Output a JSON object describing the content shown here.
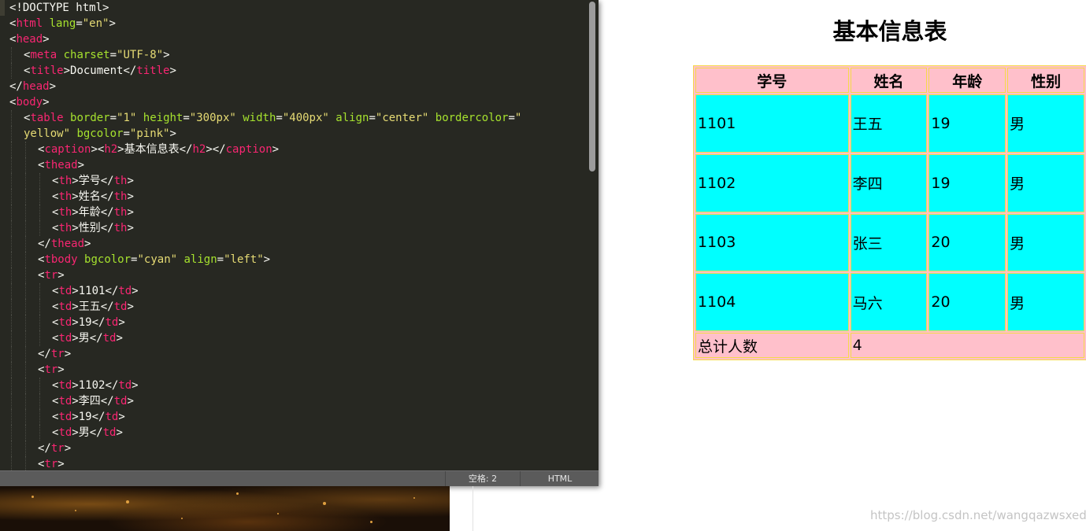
{
  "editor": {
    "lines": [
      [
        {
          "c": "p",
          "v": "<!DOCTYPE html>"
        }
      ],
      [
        {
          "c": "p",
          "v": "<"
        },
        {
          "c": "t",
          "v": "html"
        },
        {
          "c": "p",
          "v": " "
        },
        {
          "c": "a",
          "v": "lang"
        },
        {
          "c": "p",
          "v": "="
        },
        {
          "c": "s",
          "v": "\"en\""
        },
        {
          "c": "p",
          "v": ">"
        }
      ],
      [
        {
          "c": "p",
          "v": "<"
        },
        {
          "c": "t",
          "v": "head"
        },
        {
          "c": "p",
          "v": ">"
        }
      ],
      [
        {
          "c": "p",
          "v": "<"
        },
        {
          "c": "t",
          "v": "meta"
        },
        {
          "c": "p",
          "v": " "
        },
        {
          "c": "a",
          "v": "charset"
        },
        {
          "c": "p",
          "v": "="
        },
        {
          "c": "s",
          "v": "\"UTF-8\""
        },
        {
          "c": "p",
          "v": ">"
        }
      ],
      [
        {
          "c": "p",
          "v": "<"
        },
        {
          "c": "t",
          "v": "title"
        },
        {
          "c": "p",
          "v": ">Document</"
        },
        {
          "c": "t",
          "v": "title"
        },
        {
          "c": "p",
          "v": ">"
        }
      ],
      [
        {
          "c": "p",
          "v": "</"
        },
        {
          "c": "t",
          "v": "head"
        },
        {
          "c": "p",
          "v": ">"
        }
      ],
      [
        {
          "c": "p",
          "v": "<"
        },
        {
          "c": "t",
          "v": "body"
        },
        {
          "c": "p",
          "v": ">"
        }
      ],
      [
        {
          "c": "p",
          "v": "<"
        },
        {
          "c": "t",
          "v": "table"
        },
        {
          "c": "p",
          "v": " "
        },
        {
          "c": "a",
          "v": "border"
        },
        {
          "c": "p",
          "v": "="
        },
        {
          "c": "s",
          "v": "\"1\""
        },
        {
          "c": "p",
          "v": " "
        },
        {
          "c": "a",
          "v": "height"
        },
        {
          "c": "p",
          "v": "="
        },
        {
          "c": "s",
          "v": "\"300px\""
        },
        {
          "c": "p",
          "v": " "
        },
        {
          "c": "a",
          "v": "width"
        },
        {
          "c": "p",
          "v": "="
        },
        {
          "c": "s",
          "v": "\"400px\""
        },
        {
          "c": "p",
          "v": " "
        },
        {
          "c": "a",
          "v": "align"
        },
        {
          "c": "p",
          "v": "="
        },
        {
          "c": "s",
          "v": "\"center\""
        },
        {
          "c": "p",
          "v": " "
        },
        {
          "c": "a",
          "v": "bordercolor"
        },
        {
          "c": "p",
          "v": "="
        },
        {
          "c": "s",
          "v": "\""
        }
      ],
      [
        {
          "c": "s",
          "v": "yellow\""
        },
        {
          "c": "p",
          "v": " "
        },
        {
          "c": "a",
          "v": "bgcolor"
        },
        {
          "c": "p",
          "v": "="
        },
        {
          "c": "s",
          "v": "\"pink\""
        },
        {
          "c": "p",
          "v": ">"
        }
      ],
      [
        {
          "c": "p",
          "v": "<"
        },
        {
          "c": "t",
          "v": "caption"
        },
        {
          "c": "p",
          "v": "><"
        },
        {
          "c": "t",
          "v": "h2"
        },
        {
          "c": "p",
          "v": ">基本信息表</"
        },
        {
          "c": "t",
          "v": "h2"
        },
        {
          "c": "p",
          "v": "></"
        },
        {
          "c": "t",
          "v": "caption"
        },
        {
          "c": "p",
          "v": ">"
        }
      ],
      [
        {
          "c": "p",
          "v": "<"
        },
        {
          "c": "t",
          "v": "thead"
        },
        {
          "c": "p",
          "v": ">"
        }
      ],
      [
        {
          "c": "p",
          "v": "<"
        },
        {
          "c": "t",
          "v": "th"
        },
        {
          "c": "p",
          "v": ">学号</"
        },
        {
          "c": "t",
          "v": "th"
        },
        {
          "c": "p",
          "v": ">"
        }
      ],
      [
        {
          "c": "p",
          "v": "<"
        },
        {
          "c": "t",
          "v": "th"
        },
        {
          "c": "p",
          "v": ">姓名</"
        },
        {
          "c": "t",
          "v": "th"
        },
        {
          "c": "p",
          "v": ">"
        }
      ],
      [
        {
          "c": "p",
          "v": "<"
        },
        {
          "c": "t",
          "v": "th"
        },
        {
          "c": "p",
          "v": ">年龄</"
        },
        {
          "c": "t",
          "v": "th"
        },
        {
          "c": "p",
          "v": ">"
        }
      ],
      [
        {
          "c": "p",
          "v": "<"
        },
        {
          "c": "t",
          "v": "th"
        },
        {
          "c": "p",
          "v": ">性别</"
        },
        {
          "c": "t",
          "v": "th"
        },
        {
          "c": "p",
          "v": ">"
        }
      ],
      [
        {
          "c": "p",
          "v": "</"
        },
        {
          "c": "t",
          "v": "thead"
        },
        {
          "c": "p",
          "v": ">"
        }
      ],
      [
        {
          "c": "p",
          "v": "<"
        },
        {
          "c": "t",
          "v": "tbody"
        },
        {
          "c": "p",
          "v": " "
        },
        {
          "c": "a",
          "v": "bgcolor"
        },
        {
          "c": "p",
          "v": "="
        },
        {
          "c": "s",
          "v": "\"cyan\""
        },
        {
          "c": "p",
          "v": " "
        },
        {
          "c": "a",
          "v": "align"
        },
        {
          "c": "p",
          "v": "="
        },
        {
          "c": "s",
          "v": "\"left\""
        },
        {
          "c": "p",
          "v": ">"
        }
      ],
      [
        {
          "c": "p",
          "v": "<"
        },
        {
          "c": "t",
          "v": "tr"
        },
        {
          "c": "p",
          "v": ">"
        }
      ],
      [
        {
          "c": "p",
          "v": "<"
        },
        {
          "c": "t",
          "v": "td"
        },
        {
          "c": "p",
          "v": ">1101</"
        },
        {
          "c": "t",
          "v": "td"
        },
        {
          "c": "p",
          "v": ">"
        }
      ],
      [
        {
          "c": "p",
          "v": "<"
        },
        {
          "c": "t",
          "v": "td"
        },
        {
          "c": "p",
          "v": ">王五</"
        },
        {
          "c": "t",
          "v": "td"
        },
        {
          "c": "p",
          "v": ">"
        }
      ],
      [
        {
          "c": "p",
          "v": "<"
        },
        {
          "c": "t",
          "v": "td"
        },
        {
          "c": "p",
          "v": ">19</"
        },
        {
          "c": "t",
          "v": "td"
        },
        {
          "c": "p",
          "v": ">"
        }
      ],
      [
        {
          "c": "p",
          "v": "<"
        },
        {
          "c": "t",
          "v": "td"
        },
        {
          "c": "p",
          "v": ">男</"
        },
        {
          "c": "t",
          "v": "td"
        },
        {
          "c": "p",
          "v": ">"
        }
      ],
      [
        {
          "c": "p",
          "v": "</"
        },
        {
          "c": "t",
          "v": "tr"
        },
        {
          "c": "p",
          "v": ">"
        }
      ],
      [
        {
          "c": "p",
          "v": "<"
        },
        {
          "c": "t",
          "v": "tr"
        },
        {
          "c": "p",
          "v": ">"
        }
      ],
      [
        {
          "c": "p",
          "v": "<"
        },
        {
          "c": "t",
          "v": "td"
        },
        {
          "c": "p",
          "v": ">1102</"
        },
        {
          "c": "t",
          "v": "td"
        },
        {
          "c": "p",
          "v": ">"
        }
      ],
      [
        {
          "c": "p",
          "v": "<"
        },
        {
          "c": "t",
          "v": "td"
        },
        {
          "c": "p",
          "v": ">李四</"
        },
        {
          "c": "t",
          "v": "td"
        },
        {
          "c": "p",
          "v": ">"
        }
      ],
      [
        {
          "c": "p",
          "v": "<"
        },
        {
          "c": "t",
          "v": "td"
        },
        {
          "c": "p",
          "v": ">19</"
        },
        {
          "c": "t",
          "v": "td"
        },
        {
          "c": "p",
          "v": ">"
        }
      ],
      [
        {
          "c": "p",
          "v": "<"
        },
        {
          "c": "t",
          "v": "td"
        },
        {
          "c": "p",
          "v": ">男</"
        },
        {
          "c": "t",
          "v": "td"
        },
        {
          "c": "p",
          "v": ">"
        }
      ],
      [
        {
          "c": "p",
          "v": "</"
        },
        {
          "c": "t",
          "v": "tr"
        },
        {
          "c": "p",
          "v": ">"
        }
      ],
      [
        {
          "c": "p",
          "v": "<"
        },
        {
          "c": "t",
          "v": "tr"
        },
        {
          "c": "p",
          "v": ">"
        }
      ]
    ],
    "indent_levels": [
      0,
      0,
      0,
      1,
      1,
      0,
      0,
      1,
      1,
      2,
      2,
      3,
      3,
      3,
      3,
      2,
      2,
      2,
      3,
      3,
      3,
      3,
      2,
      2,
      3,
      3,
      3,
      3,
      2,
      2
    ]
  },
  "statusbar": {
    "indent": "空格: 2",
    "syntax": "HTML"
  },
  "preview": {
    "caption": "基本信息表",
    "headers": [
      "学号",
      "姓名",
      "年龄",
      "性别"
    ],
    "rows": [
      [
        "1101",
        "王五",
        "19",
        "男"
      ],
      [
        "1102",
        "李四",
        "19",
        "男"
      ],
      [
        "1103",
        "张三",
        "20",
        "男"
      ],
      [
        "1104",
        "马六",
        "20",
        "男"
      ]
    ],
    "footer": {
      "label": "总计人数",
      "value": "4"
    }
  },
  "watermark": "https://blog.csdn.net/wangqazwsxedc",
  "colors": {
    "editor_bg": "#272822",
    "tag": "#f92672",
    "attr": "#a6e22e",
    "string": "#e6db74",
    "plain": "#f8f8f2",
    "table_border": "#f5d94a",
    "pink": "#ffc0cb",
    "cyan": "#00ffff"
  }
}
